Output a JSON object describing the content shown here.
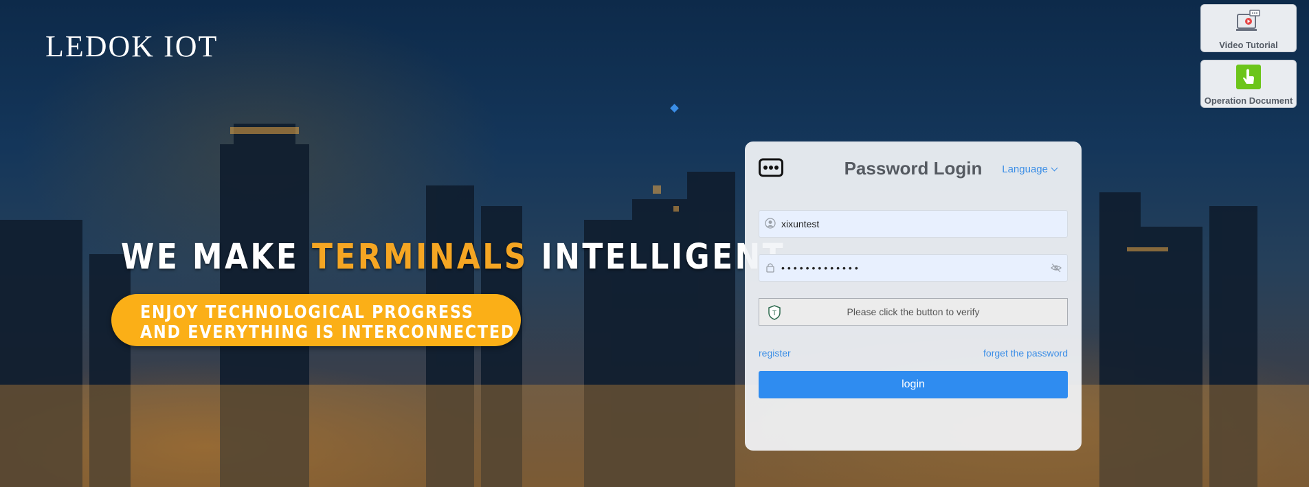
{
  "brand": {
    "name": "LEDOK IOT"
  },
  "hero": {
    "headline_part1": "WE MAKE",
    "headline_accent": "TERMINALS",
    "headline_part2": "INTELLIGENT",
    "tagline_line1": "ENJOY TECHNOLOGICAL PROGRESS",
    "tagline_line2": "AND EVERYTHING IS INTERCONNECTED"
  },
  "side_buttons": {
    "video_label": "Video Tutorial",
    "video_icon": "video-tutorial-icon",
    "doc_label": "Operation Document",
    "doc_icon": "hand-pointer-icon"
  },
  "login_card": {
    "title": "Password Login",
    "language_label": "Language",
    "username_value": "xixuntest",
    "password_value": "•••••••••••••",
    "verify_text": "Please click the button to verify",
    "register_label": "register",
    "forgot_label": "forget the password",
    "login_label": "login"
  },
  "colors": {
    "accent_orange": "#f5a623",
    "pill_orange": "#fbaf17",
    "primary_blue": "#2f8cf0",
    "link_blue": "#3b8ee6",
    "doc_green": "#6cc51a"
  }
}
